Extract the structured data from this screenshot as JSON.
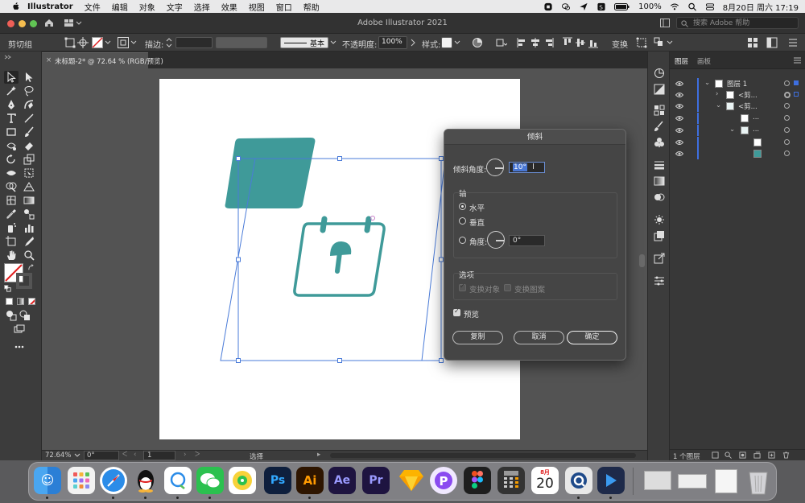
{
  "menubar": {
    "app": "Illustrator",
    "items": [
      "文件",
      "编辑",
      "对象",
      "文字",
      "选择",
      "效果",
      "视图",
      "窗口",
      "帮助"
    ],
    "battery": "100%",
    "datetime": "8月20日 周六  17:19"
  },
  "window": {
    "title": "Adobe Illustrator 2021",
    "help_placeholder": "搜索 Adobe 帮助"
  },
  "controlbar": {
    "selection": "剪切组",
    "stroke_label": "描边:",
    "brush_label": "基本",
    "opacity_label": "不透明度:",
    "opacity_value": "100%",
    "style_label": "样式:",
    "transform_label": "变换"
  },
  "document": {
    "tab": "未标题-2* @ 72.64 % (RGB/预览)"
  },
  "status": {
    "zoom": "72.64%",
    "rotation": "0°",
    "page": "1",
    "tool": "选择"
  },
  "layers": {
    "tab_layers": "图层",
    "tab_artboards": "画板",
    "rows": [
      "图层 1",
      "<剪...",
      "<剪...",
      "...",
      "..."
    ],
    "footer": "1 个图层"
  },
  "dialog": {
    "title": "倾斜",
    "shear_angle_label": "倾斜角度:",
    "shear_angle_value": "10°",
    "axis_label": "轴",
    "horizontal": "水平",
    "vertical": "垂直",
    "angle_label": "角度:",
    "angle_value": "0°",
    "options_label": "选项",
    "transform_objects": "变换对象",
    "transform_patterns": "变换图案",
    "preview": "预览",
    "copy": "复制",
    "cancel": "取消",
    "ok": "确定"
  },
  "colors": {
    "teal": "#3f9a99",
    "selection_blue": "#4a7bd8"
  },
  "dock": {
    "calendar_month": "8月",
    "calendar_day": "20"
  }
}
